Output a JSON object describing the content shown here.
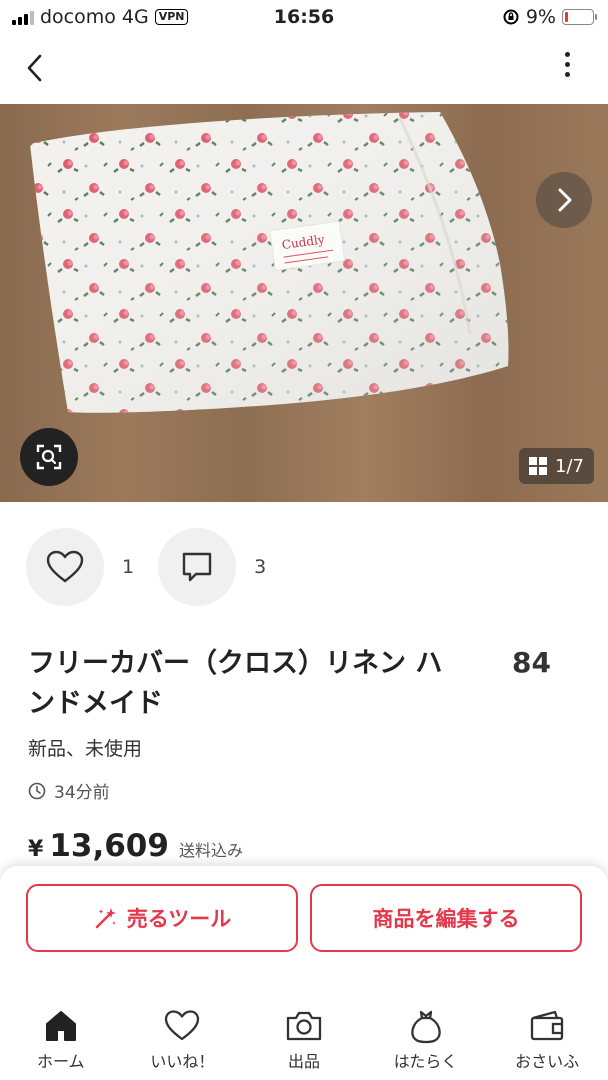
{
  "status_bar": {
    "carrier": "docomo",
    "network": "4G",
    "vpn": "VPN",
    "time": "16:56",
    "battery": "9%"
  },
  "gallery": {
    "counter": "1/7",
    "current_index": 1,
    "total": 7
  },
  "social": {
    "likes": "1",
    "comments": "3"
  },
  "item": {
    "title": "フリーカバー（クロス）リネン ハンドメイド",
    "views": "84",
    "condition": "新品、未使用",
    "posted": "34分前",
    "currency": "¥",
    "price": "13,609",
    "shipping": "送料込み",
    "tag_text": "Cuddly"
  },
  "buttons": {
    "sell_tool": "売るツール",
    "edit_item": "商品を編集する"
  },
  "tabs": [
    {
      "label": "ホーム",
      "icon": "home-icon",
      "active": true
    },
    {
      "label": "いいね！",
      "icon": "heart-icon"
    },
    {
      "label": "出品",
      "icon": "camera-icon"
    },
    {
      "label": "はたらく",
      "icon": "money-bag-icon"
    },
    {
      "label": "おさいふ",
      "icon": "wallet-icon"
    }
  ],
  "colors": {
    "accent": "#e5384b",
    "text": "#222222"
  }
}
